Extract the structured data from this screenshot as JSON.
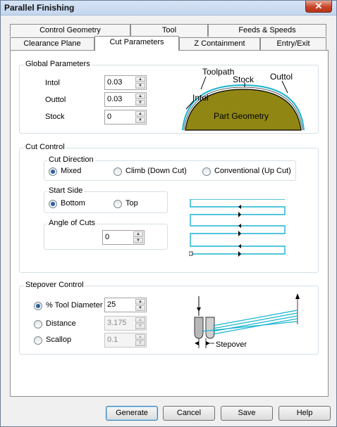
{
  "window": {
    "title": "Parallel Finishing",
    "close_glyph": "✕"
  },
  "tabs_back": [
    "Control Geometry",
    "Tool",
    "Feeds & Speeds"
  ],
  "tabs_front": [
    "Clearance Plane",
    "Cut Parameters",
    "Z Containment",
    "Entry/Exit"
  ],
  "global": {
    "label": "Global Parameters",
    "intol_label": "Intol",
    "intol_value": "0.03",
    "outtol_label": "Outtol",
    "outtol_value": "0.03",
    "stock_label": "Stock",
    "stock_value": "0",
    "diagram": {
      "toolpath": "Toolpath",
      "stock": "Stock",
      "outtol": "Outtol",
      "intol": "Intol",
      "part": "Part Geometry"
    }
  },
  "cut_control": {
    "label": "Cut Control",
    "direction_label": "Cut Direction",
    "direction_options": [
      "Mixed",
      "Climb (Down Cut)",
      "Conventional (Up Cut)"
    ],
    "direction_selected": "Mixed",
    "start_label": "Start Side",
    "start_options": [
      "Bottom",
      "Top"
    ],
    "start_selected": "Bottom",
    "angle_label": "Angle of Cuts",
    "angle_value": "0"
  },
  "stepover": {
    "label": "Stepover Control",
    "tool_diameter_label": "% Tool Diameter",
    "tool_diameter_value": "25",
    "distance_label": "Distance",
    "distance_value": "3.175",
    "scallop_label": "Scallop",
    "scallop_value": "0.1",
    "selected": "% Tool Diameter",
    "diagram_label": "Stepover"
  },
  "buttons": {
    "generate": "Generate",
    "cancel": "Cancel",
    "save": "Save",
    "help": "Help"
  },
  "colors": {
    "toolpath": "#19b4cf",
    "part_fill": "#8f8614",
    "title_bar": "#c3d6ee"
  }
}
